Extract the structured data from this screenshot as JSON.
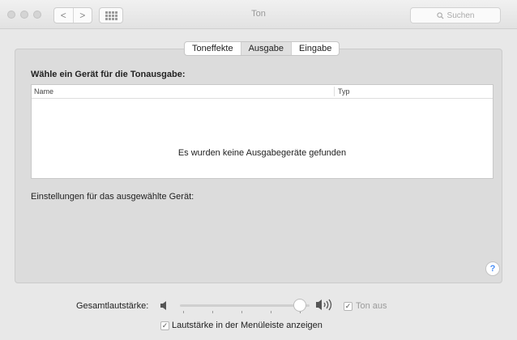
{
  "window": {
    "title": "Ton"
  },
  "toolbar": {
    "back_icon": "chevron-left",
    "forward_icon": "chevron-right",
    "grid_icon": "grid",
    "back_glyph": "<",
    "forward_glyph": ">"
  },
  "search": {
    "placeholder": "Suchen",
    "icon": "magnifier"
  },
  "tabs": [
    {
      "label": "Toneffekte",
      "active": false
    },
    {
      "label": "Ausgabe",
      "active": true
    },
    {
      "label": "Eingabe",
      "active": false
    }
  ],
  "output": {
    "heading": "Wähle ein Gerät für die Tonausgabe:",
    "columns": [
      "Name",
      "Typ"
    ],
    "empty_message": "Es wurden keine Ausgabegeräte gefunden",
    "settings_label": "Einstellungen für das ausgewählte Gerät:"
  },
  "help": {
    "glyph": "?"
  },
  "volume": {
    "label": "Gesamtlautstärke:",
    "level": 0.97,
    "mute_label": "Ton aus",
    "mute_checked": true
  },
  "menubar_option": {
    "label": "Lautstärke in der Menüleiste anzeigen",
    "checked": true
  },
  "colors": {
    "accent": "#4a8ff6",
    "panel": "#dcdcdc",
    "window": "#e8e8e8"
  }
}
